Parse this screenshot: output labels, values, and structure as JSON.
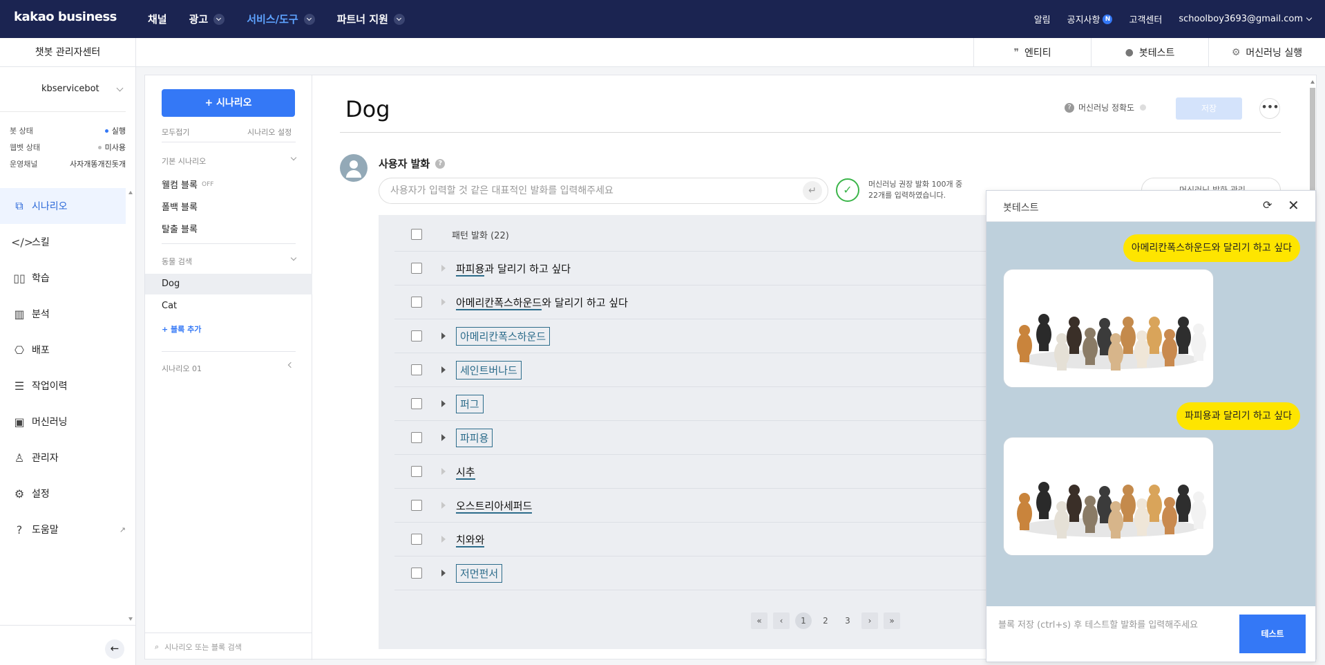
{
  "topnav": {
    "logo": "kakao business",
    "menu": [
      {
        "label": "채널",
        "dropdown": false,
        "active": false
      },
      {
        "label": "광고",
        "dropdown": true,
        "active": false
      },
      {
        "label": "서비스/도구",
        "dropdown": true,
        "active": true
      },
      {
        "label": "파트너 지원",
        "dropdown": true,
        "active": false
      }
    ],
    "right": {
      "alarm": "알림",
      "notice": "공지사항",
      "notice_badge": "N",
      "support": "고객센터",
      "account": "schoolboy3693@gmail.com"
    }
  },
  "subbar": {
    "title": "챗봇 관리자센터",
    "entity": "엔티티",
    "bottest": "봇테스트",
    "ml_run": "머신러닝 실행"
  },
  "sidebar": {
    "bot_name": "kbservicebot",
    "status": [
      {
        "label": "봇 상태",
        "value": "실행",
        "dot_color": "#3478f6"
      },
      {
        "label": "웹벳 상태",
        "value": "미사용",
        "dot_color": "#bbbbbb"
      },
      {
        "label": "운영채널",
        "value": "사자개똥개진돗개",
        "dot_color": ""
      }
    ],
    "items": [
      {
        "label": "시나리오",
        "icon": "scenario-icon",
        "active": true
      },
      {
        "label": "스킬",
        "icon": "code-icon",
        "active": false
      },
      {
        "label": "학습",
        "icon": "book-icon",
        "active": false
      },
      {
        "label": "분석",
        "icon": "chart-icon",
        "active": false
      },
      {
        "label": "배포",
        "icon": "deploy-icon",
        "active": false
      },
      {
        "label": "작업이력",
        "icon": "history-icon",
        "active": false
      },
      {
        "label": "머신러닝",
        "icon": "chip-icon",
        "active": false
      },
      {
        "label": "관리자",
        "icon": "admin-icon",
        "active": false
      },
      {
        "label": "설정",
        "icon": "settings-icon",
        "active": false
      },
      {
        "label": "도움말",
        "icon": "help-icon",
        "active": false
      }
    ]
  },
  "scenario_col": {
    "add_button": "+ 시나리오",
    "collapse_all": "모두접기",
    "scenario_settings": "시나리오 설정",
    "group_basic": "기본 시나리오",
    "basic_blocks": [
      {
        "label": "웰컴 블록",
        "badge": "OFF"
      },
      {
        "label": "폴백 블록",
        "badge": ""
      },
      {
        "label": "탈출 블록",
        "badge": ""
      }
    ],
    "group_animal": "동물 검색",
    "animal_blocks": [
      "Dog",
      "Cat"
    ],
    "add_block": "+ 블록 추가",
    "group_s01": "시나리오 01",
    "search_placeholder": "시나리오 또는 블록 검색"
  },
  "main": {
    "title": "Dog",
    "ml_accuracy": "머신러닝 정확도",
    "save": "저장",
    "user_utter_title": "사용자 발화",
    "input_placeholder": "사용자가 입력할 것 같은 대표적인 발화를 입력해주세요",
    "ml_note_1": "머신러닝 권장 발화 100개 중",
    "ml_note_2": "22개를 입력하였습니다.",
    "ml_manage": "머신러닝 발화 관리",
    "pattern_header": "패턴 발화 (22)",
    "patterns": [
      {
        "pre": "",
        "entity": "파피용",
        "post": "과 달리기 하고 싶다",
        "style": "underline",
        "expandable": false
      },
      {
        "pre": "",
        "entity": "아메리칸폭스하운드",
        "post": "와 달리기 하고 싶다",
        "style": "underline",
        "expandable": false
      },
      {
        "pre": "",
        "entity": "아메리칸폭스하운드",
        "post": "",
        "style": "box",
        "expandable": true
      },
      {
        "pre": "",
        "entity": "세인트버나드",
        "post": "",
        "style": "box",
        "expandable": true
      },
      {
        "pre": "",
        "entity": "퍼그",
        "post": "",
        "style": "box",
        "expandable": true
      },
      {
        "pre": "",
        "entity": "파피용",
        "post": "",
        "style": "box",
        "expandable": true
      },
      {
        "pre": "",
        "entity": "시추",
        "post": "",
        "style": "underline",
        "expandable": false
      },
      {
        "pre": "",
        "entity": "오스트리아세퍼드",
        "post": "",
        "style": "underline",
        "expandable": false
      },
      {
        "pre": "",
        "entity": "치와와",
        "post": "",
        "style": "underline",
        "expandable": false
      },
      {
        "pre": "",
        "entity": "저먼펀서",
        "post": "",
        "style": "box",
        "expandable": true
      }
    ],
    "pager": {
      "first": "«",
      "prev": "‹",
      "pages": [
        "1",
        "2",
        "3"
      ],
      "current": "1",
      "next": "›",
      "last": "»"
    }
  },
  "bottest": {
    "title": "봇테스트",
    "messages": [
      {
        "type": "user",
        "text": "아메리칸폭스하운드와 달리기 하고 싶다"
      },
      {
        "type": "card"
      },
      {
        "type": "user",
        "text": "파피용과 달리기 하고 싶다"
      },
      {
        "type": "card"
      }
    ],
    "input_placeholder": "블록 저장 (ctrl+s) 후 테스트할 발화를 입력해주세요",
    "send": "테스트"
  },
  "colors": {
    "topnav_bg": "#1b2451",
    "accent": "#3478f6",
    "user_bubble": "#fee500",
    "chat_bg": "#bed0dc",
    "entity": "#2b6b8a"
  }
}
